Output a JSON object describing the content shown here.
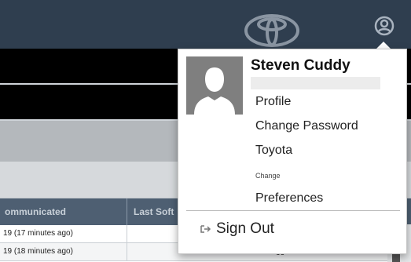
{
  "header": {
    "brand_logo": "toyota-logo",
    "user_icon": "user-circle-icon"
  },
  "table": {
    "columns": [
      {
        "label": "ommunicated"
      },
      {
        "label": "Last Soft"
      }
    ],
    "rows": [
      {
        "communicated": "19 (17 minutes ago)",
        "status": ""
      },
      {
        "communicated": "19 (18 minutes ago)",
        "status": "Not logged"
      }
    ]
  },
  "user_menu": {
    "name": "Steven Cuddy",
    "avatar_icon": "user-silhouette-icon",
    "items": [
      {
        "label": "Profile"
      },
      {
        "label": "Change Password"
      },
      {
        "label": "Toyota"
      }
    ],
    "change_caption": "Change",
    "preferences_label": "Preferences",
    "sign_out_label": "Sign Out",
    "sign_out_icon": "sign-out-icon"
  },
  "colors": {
    "topbar": "#2f3e4f",
    "table_header": "#4e5f72"
  }
}
